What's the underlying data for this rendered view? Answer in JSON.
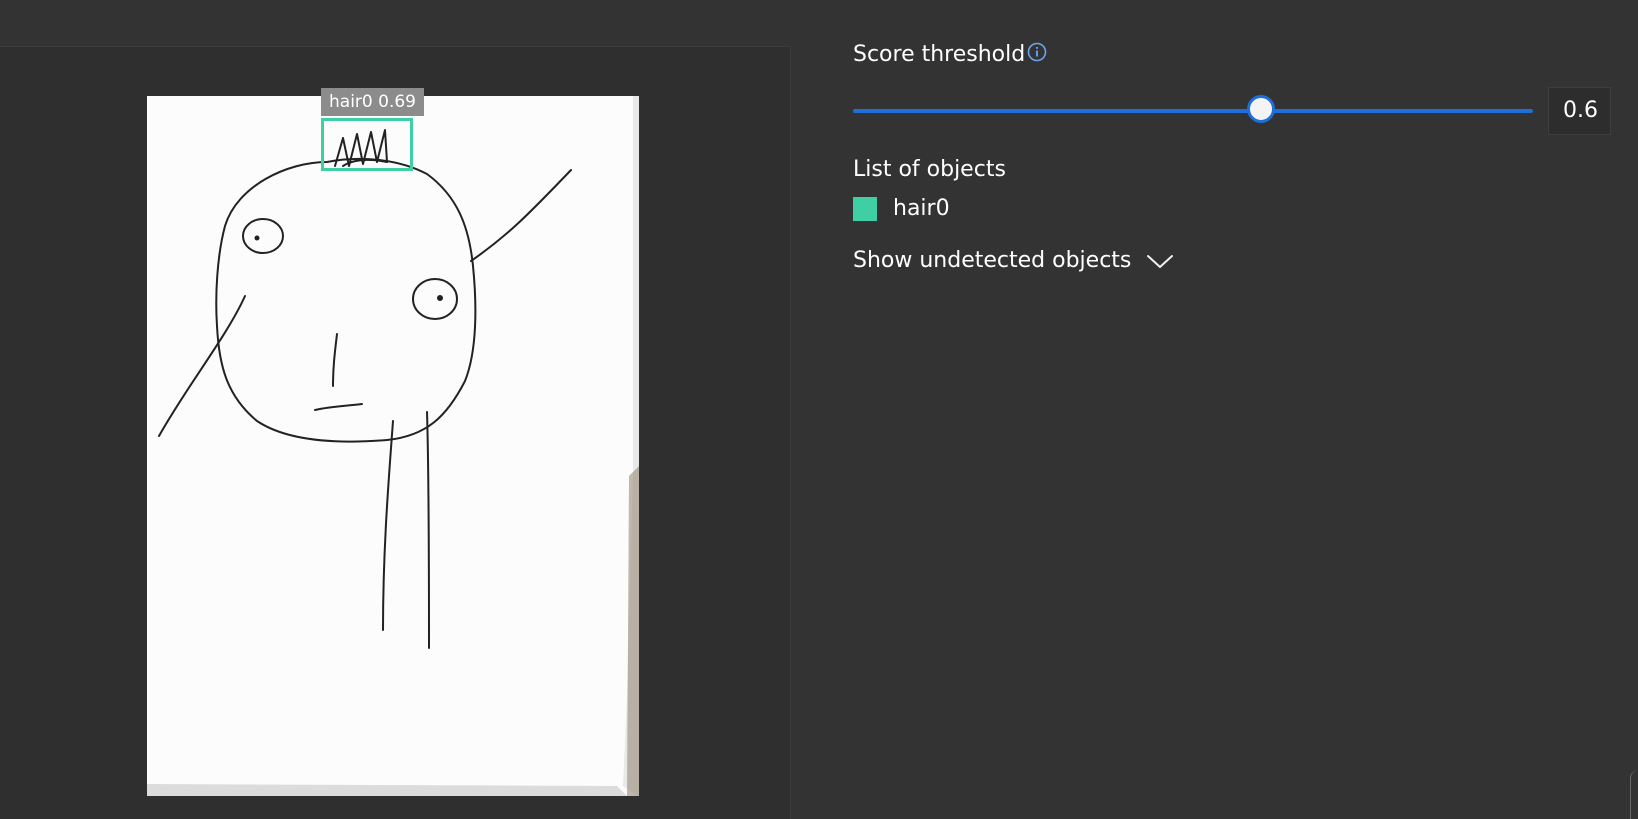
{
  "detection": {
    "label": "hair0 0.69",
    "color": "#3ecfa5"
  },
  "threshold": {
    "title": "Score threshold",
    "value": "0.6",
    "slider_fraction": 0.6,
    "accent": "#1e6fd9"
  },
  "objects": {
    "title": "List of objects",
    "items": [
      {
        "label": "hair0",
        "color": "#3ecfa5"
      }
    ]
  },
  "undetected": {
    "label": "Show undetected objects"
  },
  "icons": {
    "info": "info-icon",
    "chevron": "chevron-down-icon"
  }
}
